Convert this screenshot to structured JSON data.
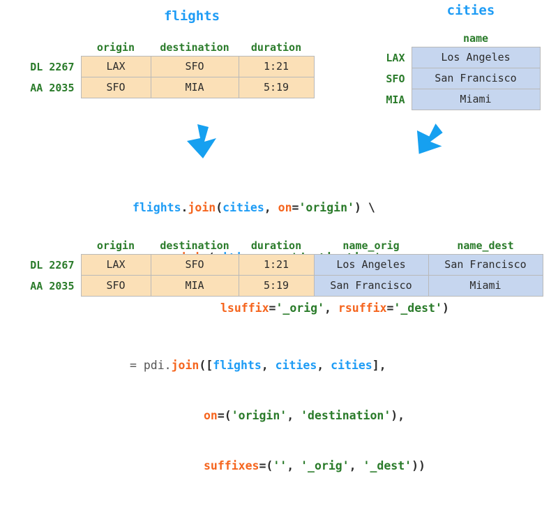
{
  "flights_table": {
    "title": "flights",
    "columns": [
      "origin",
      "destination",
      "duration"
    ],
    "row_labels": [
      "DL 2267",
      "AA 2035"
    ],
    "rows": [
      [
        "LAX",
        "SFO",
        "1:21"
      ],
      [
        "SFO",
        "MIA",
        "5:19"
      ]
    ],
    "cell_color": "#fbe0b7"
  },
  "cities_table": {
    "title": "cities",
    "columns": [
      "name"
    ],
    "row_labels": [
      "LAX",
      "SFO",
      "MIA"
    ],
    "rows": [
      [
        "Los Angeles"
      ],
      [
        "San Francisco"
      ],
      [
        "Miami"
      ]
    ],
    "cell_color": "#c6d6ef"
  },
  "result_table": {
    "columns": [
      "origin",
      "destination",
      "duration",
      "name_orig",
      "name_dest"
    ],
    "row_labels": [
      "DL 2267",
      "AA 2035"
    ],
    "rows": [
      [
        "LAX",
        "SFO",
        "1:21",
        "Los Angeles",
        "San Francisco"
      ],
      [
        "SFO",
        "MIA",
        "5:19",
        "San Francisco",
        "Miami"
      ]
    ],
    "left_cell_color": "#fbe0b7",
    "right_cell_color": "#c6d6ef"
  },
  "arrows": {
    "left_arrow": "down-arrow-icon",
    "right_arrow": "down-left-arrow-icon",
    "color": "#16a0f0"
  },
  "code_top": {
    "line1": {
      "obj1": "flights",
      "dot1": ".",
      "fn1": "join",
      "open1": "(",
      "obj2": "cities",
      "comma1": ", ",
      "kw1": "on",
      "eq1": "=",
      "str1": "'origin'",
      "close1": ")",
      "cont": " \\"
    },
    "line2": {
      "dot2": ".",
      "fn2": "join",
      "open2": "(",
      "obj3": "cities",
      "comma2": ", ",
      "kw2": "on",
      "eq2": "=",
      "str2": "'destination'",
      "comma3": ","
    },
    "line3": {
      "kw3": "lsuffix",
      "eq3": "=",
      "str3": "'_orig'",
      "comma4": ", ",
      "kw4": "rsuffix",
      "eq4": "=",
      "str4": "'_dest'",
      "close3": ")"
    }
  },
  "code_bottom": {
    "line1": {
      "prefix": "= pdi",
      "dot1": ".",
      "fn1": "join",
      "open1": "([",
      "obj1": "flights",
      "comma1": ", ",
      "obj2": "cities",
      "comma2": ", ",
      "obj3": "cities",
      "close1": "],"
    },
    "line2": {
      "kw1": "on",
      "eq1": "=(",
      "str1": "'origin'",
      "comma1": ", ",
      "str2": "'destination'",
      "close1": "),"
    },
    "line3": {
      "kw2": "suffixes",
      "eq2": "=(",
      "str3": "''",
      "comma2": ", ",
      "str4": "'_orig'",
      "comma3": ", ",
      "str5": "'_dest'",
      "close2": "))"
    }
  },
  "colors": {
    "title_blue": "#1e9cf5",
    "header_green": "#2a7b2a",
    "arrow_blue": "#16a0f0",
    "orange_cell": "#fbe0b7",
    "blue_cell": "#c6d6ef",
    "code_string_green": "#2a7b2a",
    "code_keyword_orange": "#f5651e"
  }
}
